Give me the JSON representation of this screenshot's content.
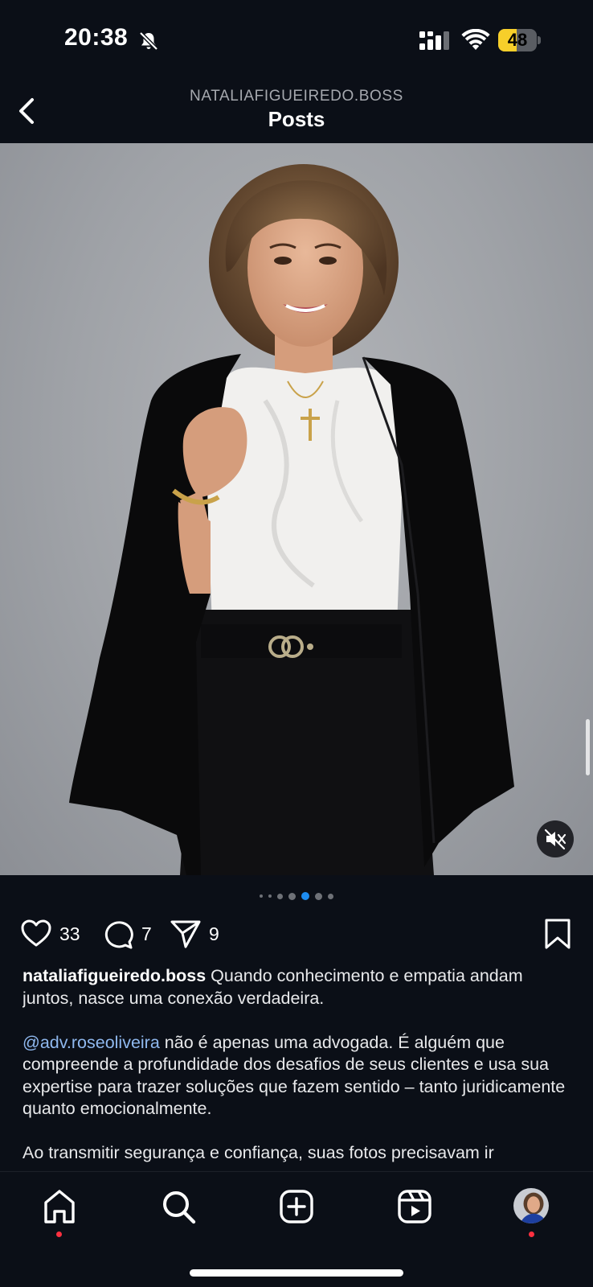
{
  "status_bar": {
    "time": "20:38",
    "battery_level": "48",
    "battery_fraction": 0.48,
    "icons": [
      "bell-slash-icon",
      "cellular-signal-icon",
      "wifi-icon",
      "battery-icon"
    ]
  },
  "header": {
    "subtitle": "NATALIAFIGUEIREDO.BOSS",
    "title": "Posts",
    "back_icon": "chevron-left-icon"
  },
  "post": {
    "media_icons": [
      "mute-icon"
    ],
    "carousel": {
      "total": 7,
      "active_index": 4
    },
    "likes": "33",
    "comments": "7",
    "shares": "9",
    "action_icons": [
      "heart-icon",
      "comment-icon",
      "share-icon",
      "bookmark-icon"
    ],
    "caption": {
      "username": "nataliafigueiredo.boss",
      "first": "Quando conhecimento e empatia andam juntos, nasce uma conexão verdadeira.",
      "mention": "@adv.roseoliveira",
      "second": "não é apenas uma advogada. É alguém que compreende a profundidade dos desafios de seus clientes e usa sua expertise para trazer soluções que fazem sentido – tanto juridicamente quanto emocionalmente.",
      "third": "Ao transmitir segurança e confiança, suas fotos precisavam ir"
    }
  },
  "bottom_nav": {
    "items": [
      "home-icon",
      "search-icon",
      "create-icon",
      "reels-icon",
      "profile-avatar"
    ]
  },
  "colors": {
    "background": "#0b0f17",
    "accent_blue": "#1d8cf0",
    "mention": "#8fb8ee",
    "notification_dot": "#ff3040",
    "battery": "#f7cf2a"
  }
}
